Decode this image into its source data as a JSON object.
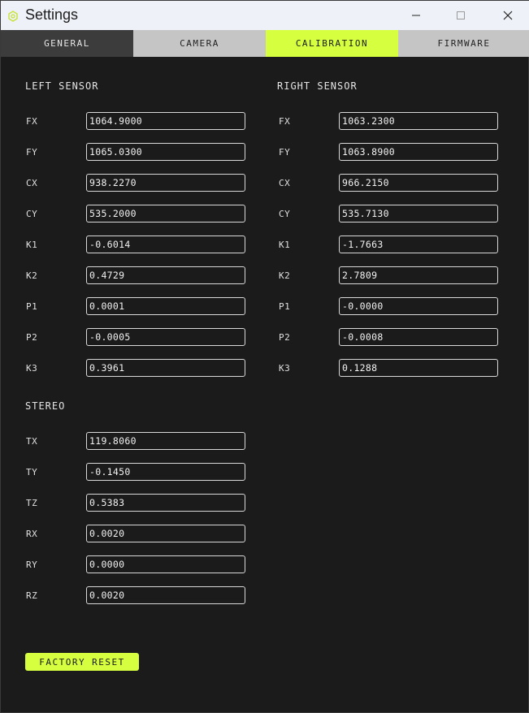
{
  "window": {
    "title": "Settings"
  },
  "tabs": [
    {
      "label": "GENERAL"
    },
    {
      "label": "CAMERA"
    },
    {
      "label": "CALIBRATION"
    },
    {
      "label": "FIRMWARE"
    }
  ],
  "active_tab": "CALIBRATION",
  "colors": {
    "accent": "#d5ff3f",
    "background": "#1b1b1b",
    "tab_inactive": "#c5c5c5",
    "tab_general": "#3c3c3c"
  },
  "left_sensor": {
    "title": "LEFT SENSOR",
    "rows": [
      {
        "label": "FX",
        "value": "1064.9000"
      },
      {
        "label": "FY",
        "value": "1065.0300"
      },
      {
        "label": "CX",
        "value": "938.2270"
      },
      {
        "label": "CY",
        "value": "535.2000"
      },
      {
        "label": "K1",
        "value": "-0.6014"
      },
      {
        "label": "K2",
        "value": "0.4729"
      },
      {
        "label": "P1",
        "value": "0.0001"
      },
      {
        "label": "P2",
        "value": "-0.0005"
      },
      {
        "label": "K3",
        "value": "0.3961"
      }
    ]
  },
  "right_sensor": {
    "title": "RIGHT SENSOR",
    "rows": [
      {
        "label": "FX",
        "value": "1063.2300"
      },
      {
        "label": "FY",
        "value": "1063.8900"
      },
      {
        "label": "CX",
        "value": "966.2150"
      },
      {
        "label": "CY",
        "value": "535.7130"
      },
      {
        "label": "K1",
        "value": "-1.7663"
      },
      {
        "label": "K2",
        "value": "2.7809"
      },
      {
        "label": "P1",
        "value": "-0.0000"
      },
      {
        "label": "P2",
        "value": "-0.0008"
      },
      {
        "label": "K3",
        "value": "0.1288"
      }
    ]
  },
  "stereo": {
    "title": "STEREO",
    "rows": [
      {
        "label": "TX",
        "value": "119.8060"
      },
      {
        "label": "TY",
        "value": "-0.1450"
      },
      {
        "label": "TZ",
        "value": "0.5383"
      },
      {
        "label": "RX",
        "value": "0.0020"
      },
      {
        "label": "RY",
        "value": "0.0000"
      },
      {
        "label": "RZ",
        "value": "0.0020"
      }
    ]
  },
  "actions": {
    "factory_reset": "FACTORY RESET"
  }
}
